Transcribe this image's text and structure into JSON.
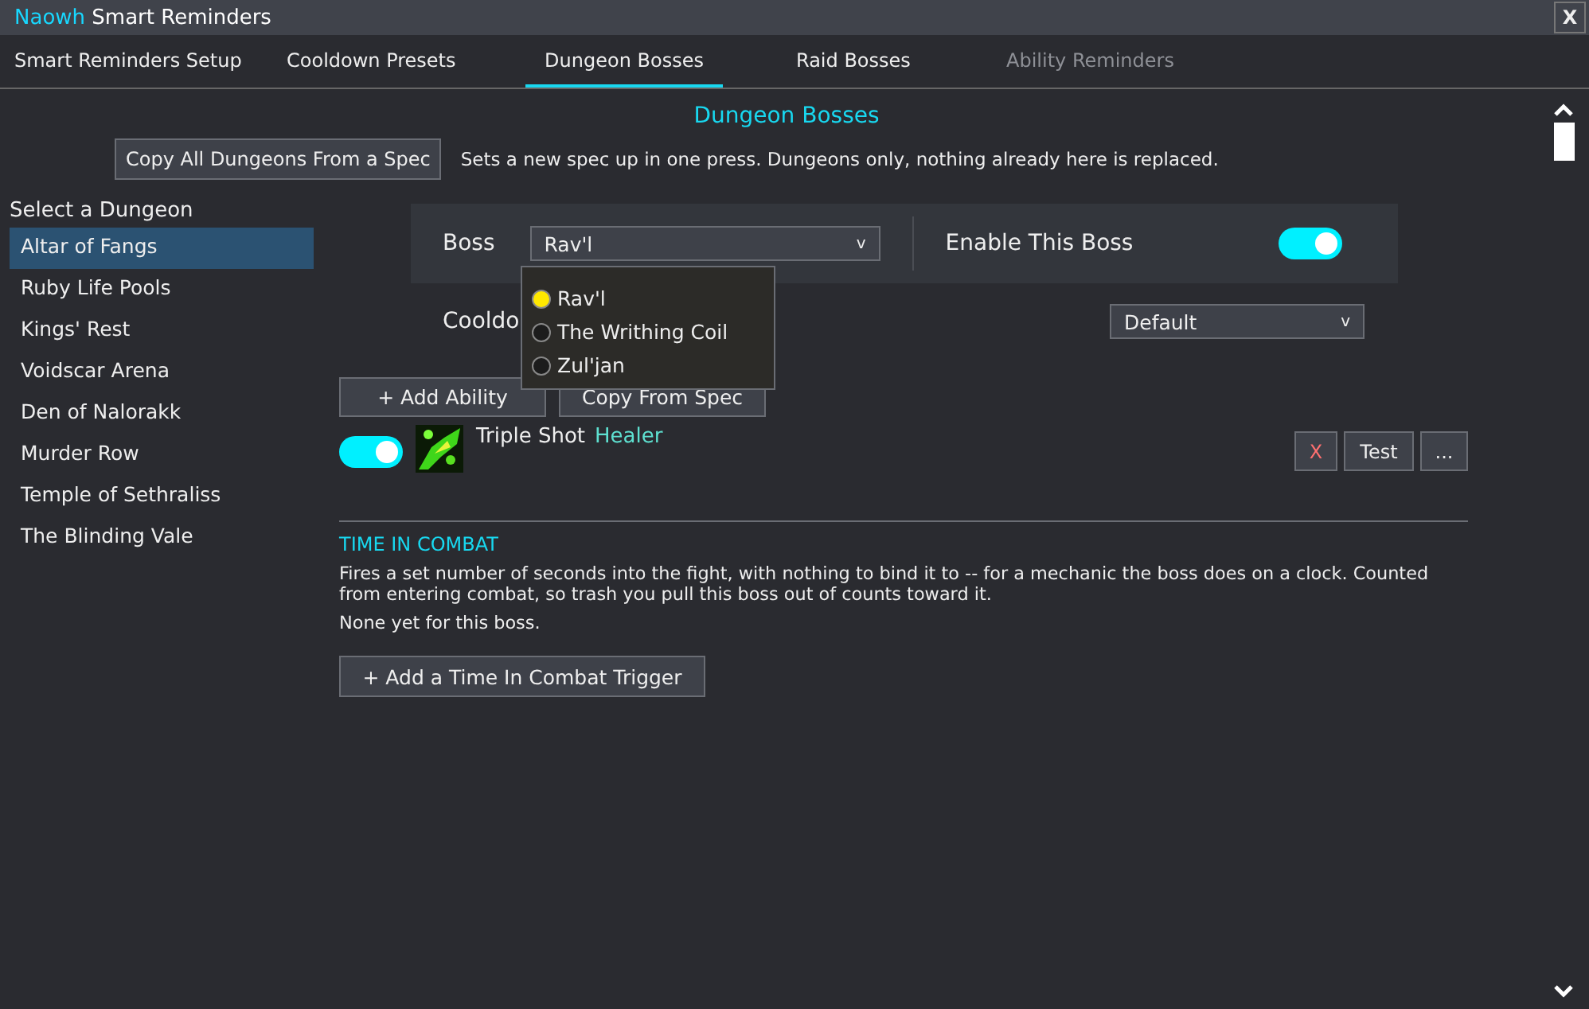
{
  "window": {
    "brand": "Naowh",
    "title": "Smart Reminders",
    "close": "X"
  },
  "tabs": [
    {
      "label": "Smart Reminders Setup",
      "selected": false,
      "disabled": false
    },
    {
      "label": "Cooldown Presets",
      "selected": false,
      "disabled": false
    },
    {
      "label": "Dungeon Bosses",
      "selected": true,
      "disabled": false
    },
    {
      "label": "Raid Bosses",
      "selected": false,
      "disabled": false
    },
    {
      "label": "Ability Reminders",
      "selected": false,
      "disabled": true
    }
  ],
  "heading": "Dungeon Bosses",
  "copy_all": {
    "button": "Copy All Dungeons From a Spec",
    "hint": "Sets a new spec up in one press. Dungeons only, nothing already here is replaced."
  },
  "sidebar": {
    "heading": "Select a Dungeon",
    "items": [
      {
        "label": "Altar of Fangs",
        "selected": true
      },
      {
        "label": "Ruby Life Pools",
        "selected": false
      },
      {
        "label": "Kings' Rest",
        "selected": false
      },
      {
        "label": "Voidscar Arena",
        "selected": false
      },
      {
        "label": "Den of Nalorakk",
        "selected": false
      },
      {
        "label": "Murder Row",
        "selected": false
      },
      {
        "label": "Temple of Sethraliss",
        "selected": false
      },
      {
        "label": "The Blinding Vale",
        "selected": false
      }
    ]
  },
  "boss_panel": {
    "label": "Boss",
    "value": "Rav'l",
    "caret": "v",
    "enable_label": "Enable This Boss",
    "enabled": true
  },
  "boss_menu": [
    {
      "label": "Rav'l",
      "selected": true
    },
    {
      "label": "The Writhing Coil",
      "selected": false
    },
    {
      "label": "Zul'jan",
      "selected": false
    }
  ],
  "cooldown": {
    "label": "Cooldo",
    "value": "Default",
    "caret": "v"
  },
  "buttons": [
    "+ Add Ability",
    "Copy From Spec"
  ],
  "abilities": [
    {
      "enabled": true,
      "name": "Triple Shot",
      "role": "Healer",
      "actions": [
        "X",
        "Test",
        "..."
      ]
    }
  ],
  "section": {
    "title": "TIME IN COMBAT",
    "description": "Fires a set number of seconds into the fight, with nothing to bind it to -- for a mechanic the boss does on a clock. Counted from entering combat, so trash you pull this boss out of counts toward it.",
    "empty": "None yet for this boss.",
    "button": "+ Add a Time In Combat Trigger"
  }
}
